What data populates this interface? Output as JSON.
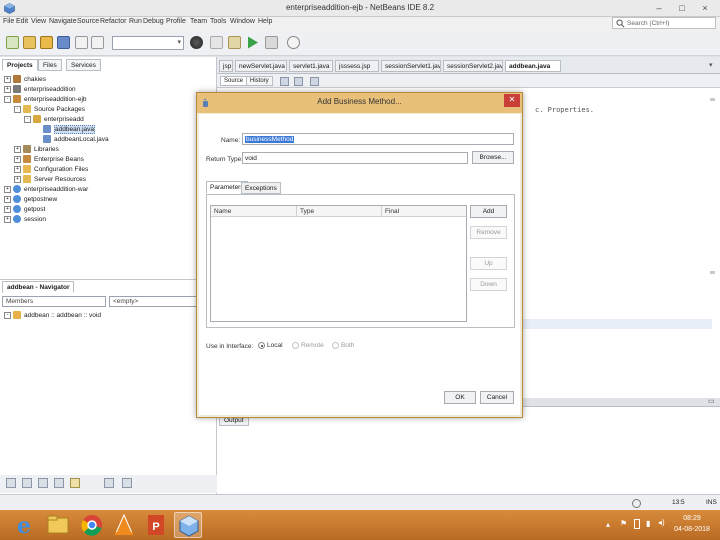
{
  "window": {
    "title": "enterpriseaddition-ejb - NetBeans IDE 8.2",
    "controls": [
      "–",
      "□",
      "×"
    ]
  },
  "menubar": [
    "File",
    "Edit",
    "View",
    "Navigate",
    "Source",
    "Refactor",
    "Run",
    "Debug",
    "Profile",
    "Team",
    "Tools",
    "Window",
    "Help"
  ],
  "search": {
    "placeholder": "Search (Ctrl+I)"
  },
  "projects_panel": {
    "tabs": [
      "Projects",
      "Files",
      "Services"
    ],
    "tree": [
      {
        "label": "chakies",
        "indent": 0,
        "icon": "coffee-cup-icon",
        "expander": "+"
      },
      {
        "label": "enterpriseaddition",
        "indent": 0,
        "icon": "triangle-icon",
        "expander": "+"
      },
      {
        "label": "enterpriseaddition-ejb",
        "indent": 0,
        "icon": "bean-icon",
        "expander": "-"
      },
      {
        "label": "Source Packages",
        "indent": 1,
        "icon": "folder-icon",
        "expander": "-"
      },
      {
        "label": "enterpriseadd",
        "indent": 2,
        "icon": "package-icon",
        "expander": "-"
      },
      {
        "label": "addbean.java",
        "indent": 3,
        "icon": "java-file-icon",
        "expander": "",
        "selected": true
      },
      {
        "label": "addbeanLocal.java",
        "indent": 3,
        "icon": "java-file-icon",
        "expander": ""
      },
      {
        "label": "Libraries",
        "indent": 1,
        "icon": "library-icon",
        "expander": "+"
      },
      {
        "label": "Enterprise Beans",
        "indent": 1,
        "icon": "bean-icon",
        "expander": "+"
      },
      {
        "label": "Configuration Files",
        "indent": 1,
        "icon": "folder-icon",
        "expander": "+"
      },
      {
        "label": "Server Resources",
        "indent": 1,
        "icon": "folder-icon",
        "expander": "+"
      },
      {
        "label": "enterpriseaddition-war",
        "indent": 0,
        "icon": "globe-icon",
        "expander": "+"
      },
      {
        "label": "getpostnew",
        "indent": 0,
        "icon": "globe-icon",
        "expander": "+"
      },
      {
        "label": "getpost",
        "indent": 0,
        "icon": "globe-icon",
        "expander": "+"
      },
      {
        "label": "session",
        "indent": 0,
        "icon": "globe-icon",
        "expander": "+"
      }
    ]
  },
  "navigator_panel": {
    "tabs": [
      "addbean - Navigator"
    ],
    "members_combo": "Members",
    "filter_combo": "<empty>",
    "tree": [
      {
        "label": "addbean :: addbean :: void"
      }
    ]
  },
  "editor": {
    "tabs": [
      "jsp",
      "newServlet.java",
      "servlet1.java",
      "jsssess.jsp",
      "sessionServlet1.java",
      "sessionServlet2.java",
      "addbean.java"
    ],
    "active_tab": "addbean.java",
    "subtabs": [
      "Source",
      "History"
    ],
    "code_line": "c. Properties.",
    "brace": "e"
  },
  "output": {
    "tab": "Output"
  },
  "statusbar": {
    "position": "13:5",
    "mode": "INS"
  },
  "taskbar": {
    "time": "08:29",
    "date": "04-08-2018",
    "apps": [
      "internet-explorer-icon",
      "file-explorer-icon",
      "chrome-icon",
      "vlc-icon",
      "powerpoint-icon",
      "app-icon"
    ]
  },
  "dialog": {
    "title": "Add Business Method...",
    "name_label": "Name:",
    "name_value": "businessMethod",
    "return_label": "Return Type:",
    "return_value": "void",
    "browse_label": "Browse...",
    "tabs": [
      "Parameters",
      "Exceptions"
    ],
    "table_headers": [
      "Name",
      "Type",
      "Final"
    ],
    "side_buttons": [
      "Add",
      "Remove",
      "Up",
      "Down"
    ],
    "interface_label": "Use in Interface:",
    "interface_options": [
      "Local",
      "Remote",
      "Both"
    ],
    "ok_label": "OK",
    "cancel_label": "Cancel"
  }
}
